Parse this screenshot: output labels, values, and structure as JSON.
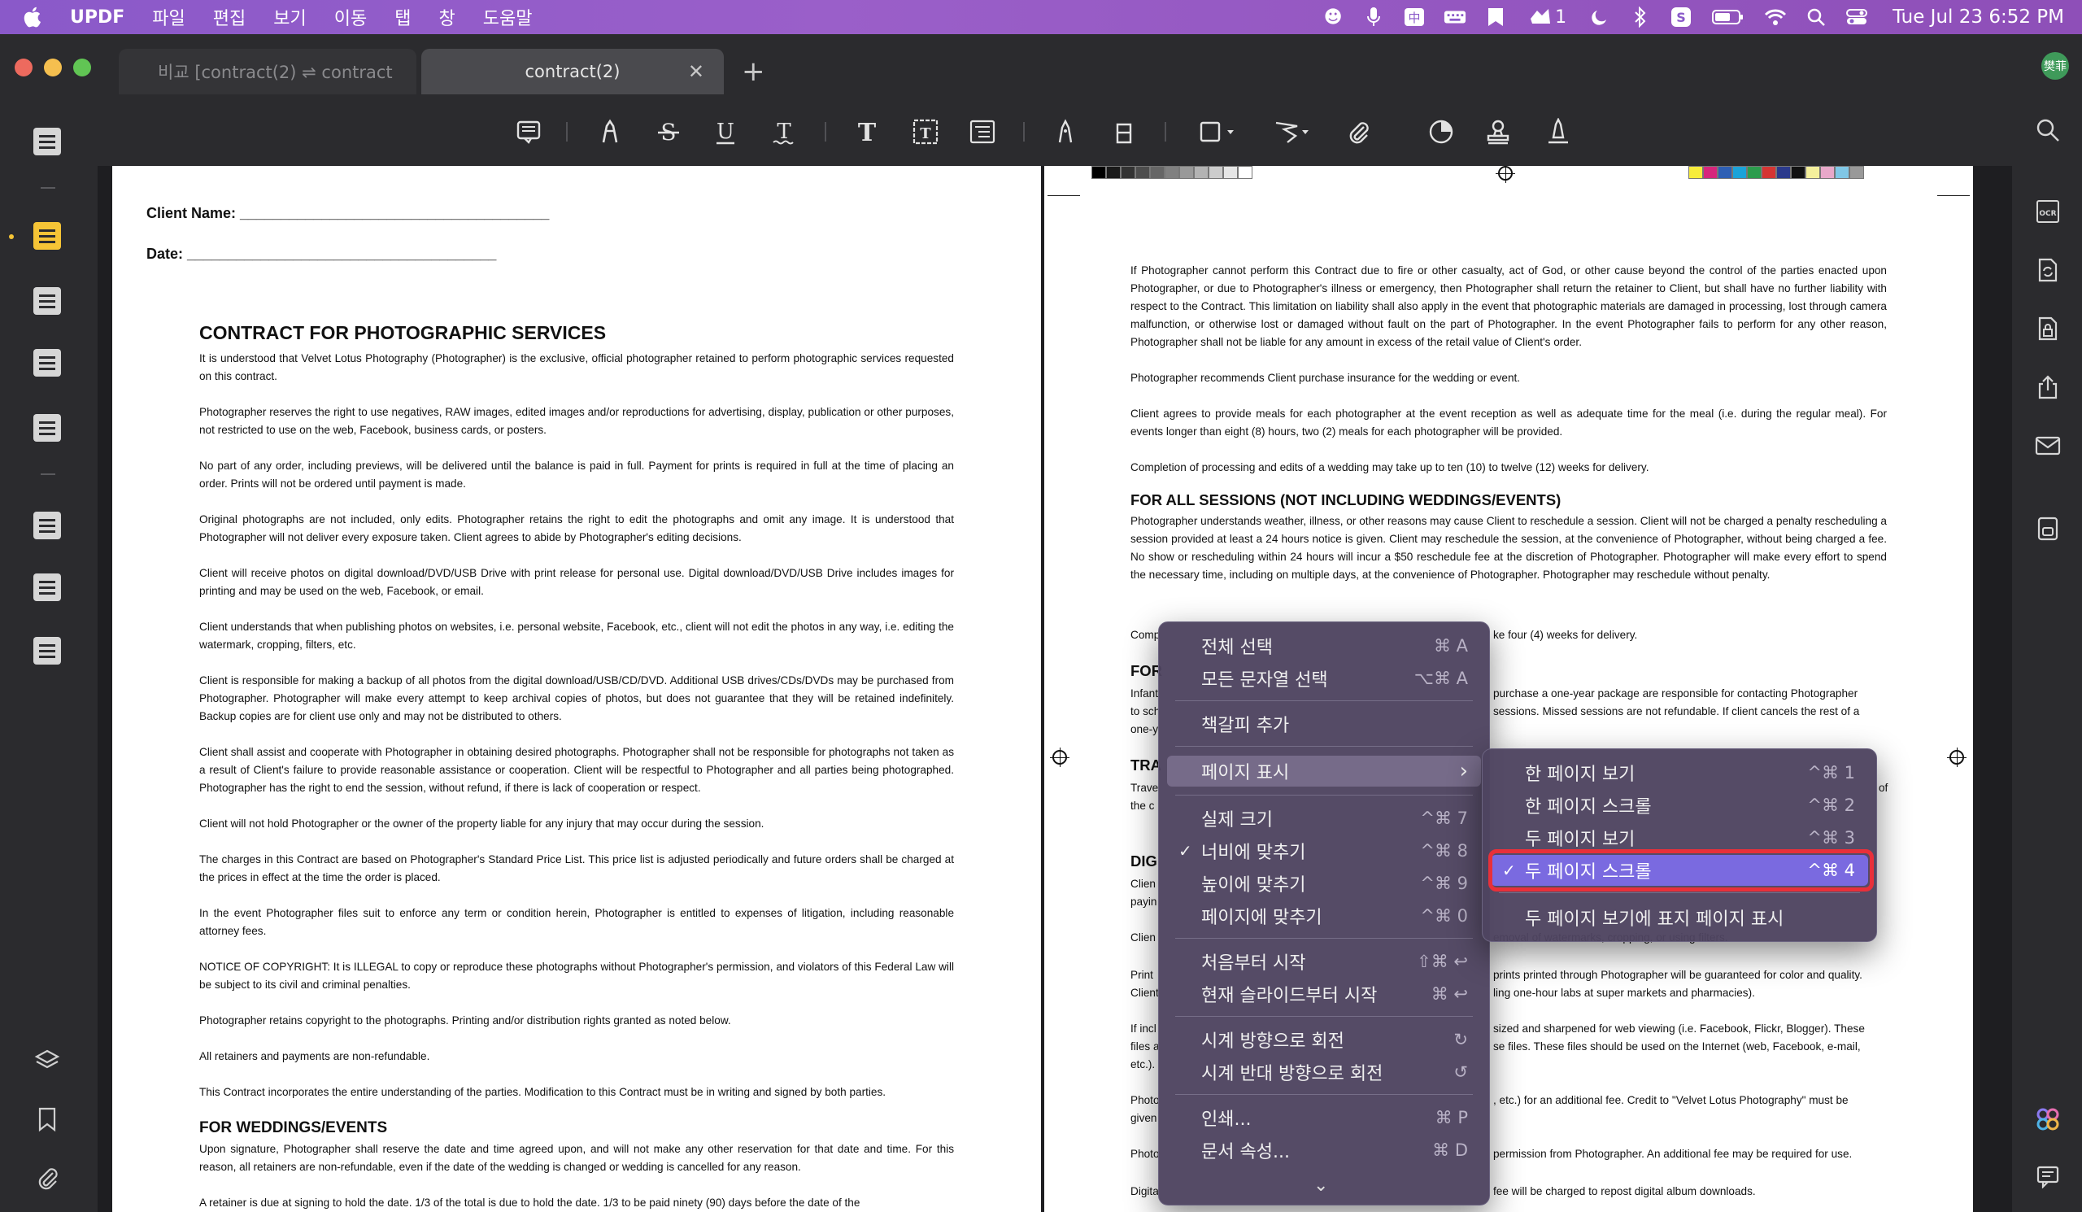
{
  "menubar": {
    "app_name": "UPDF",
    "menus": [
      "파일",
      "편집",
      "보기",
      "이동",
      "탭",
      "창",
      "도움말"
    ],
    "badge_count": "1",
    "clock": "Tue Jul 23  6:52 PM"
  },
  "tabs": {
    "inactive_label": "비교 [contract(2) ⇌ contract",
    "active_label": "contract(2)",
    "close_glyph": "✕",
    "new_tab_glyph": "+",
    "avatar_text": "樊菲"
  },
  "left_page": {
    "client_name": "Client Name: ______________________________________",
    "date": "Date: ______________________________________",
    "title": "CONTRACT FOR PHOTOGRAPHIC SERVICES",
    "paragraphs": [
      "It is understood that Velvet Lotus Photography (Photographer) is the exclusive, official photographer retained to perform photographic services requested on this contract.",
      "Photographer reserves the right to use negatives, RAW images, edited images and/or reproductions for advertising, display, publication or other purposes, not restricted to use on the web, Facebook, business cards, or posters.",
      "No part of any order, including previews, will be delivered until the balance is paid in full. Payment for prints is required in full at the time of placing an order. Prints will not be ordered until payment is made.",
      "Original photographs are not included, only edits. Photographer retains the right to edit the photographs and omit any image. It is understood that Photographer will not deliver every exposure taken. Client agrees to abide by Photographer's editing decisions.",
      "Client will receive photos on digital download/DVD/USB Drive with print release for personal use. Digital download/DVD/USB Drive includes images for printing and may be used on the web, Facebook, or email.",
      "Client understands that when publishing photos on websites, i.e. personal website, Facebook, etc., client will not edit the photos in any way, i.e. editing the watermark, cropping, filters, etc.",
      "Client is responsible for making a backup of all photos from the digital download/USB/CD/DVD. Additional USB drives/CDs/DVDs may be purchased from Photographer. Photographer will make every attempt to keep archival copies of photos, but does not guarantee that they will be retained indefinitely. Backup copies are for client use only and may not be distributed to others.",
      "Client shall assist and cooperate with Photographer in obtaining desired photographs. Photographer shall not be responsible for photographs not taken as a result of Client's failure to provide reasonable assistance or cooperation. Client will be respectful to Photographer and all parties being photographed. Photographer has the right to end the session, without refund, if there is lack of cooperation or respect.",
      "Client will not hold Photographer or the owner of the property liable for any injury that may occur during the session.",
      "The charges in this Contract are based on Photographer's Standard Price List. This price list is adjusted periodically and future orders shall be charged at the prices in effect at the time the order is placed.",
      "In the event Photographer files suit to enforce any term or condition herein, Photographer is entitled to expenses of litigation, including reasonable attorney fees.",
      "NOTICE OF COPYRIGHT: It is ILLEGAL to copy or reproduce these photographs without Photographer's permission, and violators of this Federal Law will be subject to its civil and criminal penalties.",
      "Photographer retains copyright to the photographs. Printing and/or distribution rights granted as noted below.",
      "All retainers and payments are non-refundable.",
      "This Contract incorporates the entire understanding of the parties. Modification to this Contract must be in writing and signed by both parties."
    ],
    "heading2": "FOR WEDDINGS/EVENTS",
    "weddings_paragraph": "Upon signature, Photographer shall reserve the date and time agreed upon, and will not make any other reservation for that date and time. For this reason, all retainers are non-refundable, even if the date of the wedding is changed or wedding is cancelled for any reason.",
    "last_line": "A retainer is due at signing to hold the date. 1/3 of the total is due to hold the date. 1/3 to be paid ninety (90) days before the date of the"
  },
  "right_page": {
    "p1": "If Photographer cannot perform this Contract due to fire or other casualty, act of God, or other cause beyond the control of the parties enacted upon Photographer, or due to Photographer's illness or emergency, then Photographer shall return the retainer to Client, but shall have no further liability with respect to the Contract. This limitation on liability shall also apply in the event that photographic materials are damaged in processing, lost through camera malfunction, or otherwise lost or damaged without fault on the part of Photographer. In the event Photographer fails to perform for any other reason, Photographer shall not be liable for any amount in excess of the retail value of Client's order.",
    "p2": "Photographer recommends Client purchase insurance for the wedding or event.",
    "p3": "Client agrees to provide meals for each photographer at the event reception as well as adequate time for the meal (i.e. during the regular meal). For events longer than eight (8) hours, two (2) meals for each photographer will be provided.",
    "p4": "Completion of processing and edits of a wedding may take up to ten (10) to twelve (12) weeks for delivery.",
    "heading": "FOR ALL SESSIONS (NOT INCLUDING WEDDINGS/EVENTS)",
    "p5": "Photographer understands weather, illness, or other reasons may cause Client to reschedule a session. Client will not be charged a penalty rescheduling a session provided at least a 24 hours notice is given. Client may reschedule the session, at the convenience of Photographer, without being charged a fee. No show or rescheduling within 24 hours will incur a $50 reschedule fee at the discretion of Photographer. Photographer will make every effort to spend the necessary time, including on multiple days, at the convenience of Photographer. Photographer may reschedule without penalty.",
    "frag_comp": "Comp",
    "frag_comp_r": "ke four (4) weeks for delivery.",
    "frag_for": "FOR",
    "frag_infant": "Infant",
    "frag_infant_r": "purchase a one-year package are responsible for contacting Photographer",
    "frag_tosch": "to sch",
    "frag_tosch_r": "sessions. Missed sessions are not refundable. If client cancels the rest of a",
    "frag_oney": "one-y",
    "frag_tra": "TRA",
    "frag_trave": "Trave",
    "frag_trave_r": "of",
    "frag_thec": "the c",
    "frag_dig": "DIG",
    "frag_clien": "Clien",
    "frag_payin": "payin",
    "frag_clien2": "Clien",
    "frag_clien2_r": "emoval of watermarks, cropping, or using filters.",
    "frag_print": "Print",
    "frag_print_r": "prints printed through Photographer will be guaranteed for color and quality.",
    "frag_client3": "Client",
    "frag_client3_r": "ling one-hour labs at super markets and pharmacies).",
    "frag_ifincl": "If incl",
    "frag_ifincl_r": "sized and sharpened for web viewing (i.e. Facebook, Flickr, Blogger). These",
    "frag_filesa": "files a",
    "frag_filesa_r": "se files. These files should be used on the Internet (web, Facebook, e-mail,",
    "frag_etc": "etc.).",
    "frag_photo": "Photo",
    "frag_photo_r": ", etc.) for an additional fee. Credit to \"Velvet Lotus Photography\" must be",
    "frag_given": "given",
    "frag_photo2": "Photo",
    "frag_photo2_r": "permission from Photographer. An additional fee may be required for use.",
    "frag_digita": "Digita",
    "frag_digita_r": "fee will be charged to repost digital album downloads."
  },
  "context_menu": {
    "items": [
      {
        "label": "전체 선택",
        "shortcut": "⌘ A"
      },
      {
        "label": "모든 문자열 선택",
        "shortcut": "⌥⌘ A"
      },
      {
        "label": "책갈피 추가",
        "shortcut": ""
      },
      {
        "label": "페이지 표시",
        "shortcut": "›"
      },
      {
        "label": "실제 크기",
        "shortcut": "^⌘ 7"
      },
      {
        "label": "너비에 맞추기",
        "shortcut": "^⌘ 8",
        "check": "✓"
      },
      {
        "label": "높이에 맞추기",
        "shortcut": "^⌘ 9"
      },
      {
        "label": "페이지에 맞추기",
        "shortcut": "^⌘ 0"
      },
      {
        "label": "처음부터 시작",
        "shortcut": "⇧⌘ ↩"
      },
      {
        "label": "현재 슬라이드부터 시작",
        "shortcut": "⌘ ↩"
      },
      {
        "label": "시계 방향으로 회전",
        "shortcut": "↻"
      },
      {
        "label": "시계 반대 방향으로 회전",
        "shortcut": "↺"
      },
      {
        "label": "인쇄...",
        "shortcut": "⌘ P"
      },
      {
        "label": "문서 속성...",
        "shortcut": "⌘ D"
      }
    ],
    "more_glyph": "⌄"
  },
  "submenu": {
    "items": [
      {
        "label": "한 페이지 보기",
        "shortcut": "^⌘ 1"
      },
      {
        "label": "한 페이지 스크롤",
        "shortcut": "^⌘ 2"
      },
      {
        "label": "두 페이지 보기",
        "shortcut": "^⌘ 3"
      },
      {
        "label": "두 페이지 스크롤",
        "shortcut": "^⌘ 4",
        "check": "✓"
      },
      {
        "label": "두 페이지 보기에 표지 페이지 표시",
        "shortcut": ""
      }
    ]
  },
  "colors": {
    "menubar_gradient_start": "#8a59c9",
    "app_bg": "#2b2b2e",
    "menu_bg": "#4e4460",
    "selected": "#7a6ae0",
    "highlight_box": "#e8303a",
    "sidebar_active": "#f5c436"
  }
}
